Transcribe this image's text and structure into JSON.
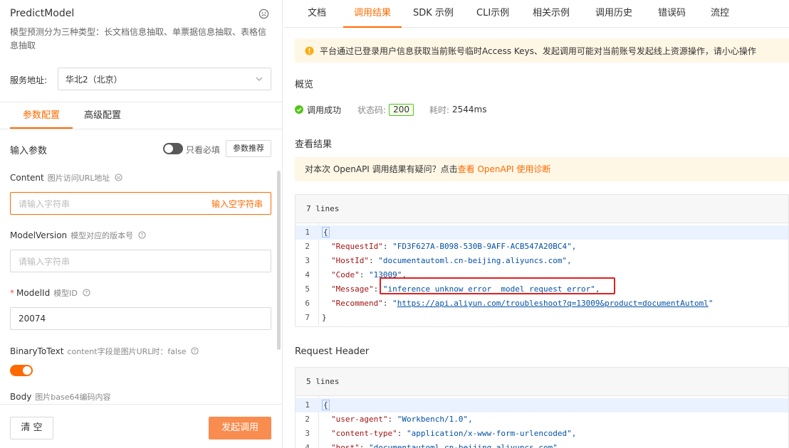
{
  "left": {
    "api_name": "PredictModel",
    "api_desc": "模型预测分为三种类型：长文档信息抽取、单票据信息抽取、表格信息抽取",
    "service_label": "服务地址:",
    "service_value": "华北2（北京）",
    "tabs": [
      {
        "label": "参数配置",
        "active": true
      },
      {
        "label": "高级配置",
        "active": false
      }
    ],
    "input_params_label": "输入参数",
    "only_required_label": "只看必填",
    "recommend_button": "参数推荐",
    "fields": [
      {
        "name": "Content",
        "hint": "图片访问URL地址",
        "placeholder": "请输入字符串",
        "action": "输入空字符串",
        "required": false
      },
      {
        "name": "ModelVersion",
        "hint": "模型对应的版本号",
        "placeholder": "请输入字符串",
        "required": false
      },
      {
        "name": "ModelId",
        "hint": "模型ID",
        "value": "20074",
        "required": true
      },
      {
        "name": "BinaryToText",
        "hint": "content字段是图片URL时：false",
        "toggle_on": true,
        "required": false
      },
      {
        "name": "Body",
        "hint": "图片base64编码内容",
        "required": false
      }
    ],
    "clear_button": "清 空",
    "send_button": "发起调用"
  },
  "right": {
    "tabs": [
      {
        "label": "文档",
        "active": false
      },
      {
        "label": "调用结果",
        "active": true
      },
      {
        "label": "SDK 示例",
        "active": false
      },
      {
        "label": "CLI示例",
        "active": false
      },
      {
        "label": "相关示例",
        "active": false
      },
      {
        "label": "调用历史",
        "active": false
      },
      {
        "label": "错误码",
        "active": false
      },
      {
        "label": "流控",
        "active": false
      }
    ],
    "warning": "平台通过已登录用户信息获取当前账号临时Access Keys、发起调用可能对当前账号发起线上资源操作，请小心操作",
    "overview_title": "概览",
    "status_text": "调用成功",
    "status_code_label": "状态码:",
    "status_code": "200",
    "elapsed_label": "耗时:",
    "elapsed": "2544ms",
    "result_title": "查看结果",
    "tip_prefix": "对本次 OpenAPI 调用结果有疑问？点击",
    "tip_link": "查看 OpenAPI 使用诊断",
    "result_lines_label": "7 lines",
    "result_lines": [
      {
        "n": "1",
        "key": "",
        "val": "{"
      },
      {
        "n": "2",
        "key": "\"RequestId\"",
        "val": "\"FD3F627A-B098-530B-9AFF-ACB547A20BC4\","
      },
      {
        "n": "3",
        "key": "\"HostId\"",
        "val": "\"documentautoml.cn-beijing.aliyuncs.com\","
      },
      {
        "n": "4",
        "key": "\"Code\"",
        "val": "\"13009\","
      },
      {
        "n": "5",
        "key": "\"Message\"",
        "val": "\"inference unknow error  model request error\","
      },
      {
        "n": "6",
        "key": "\"Recommend\"",
        "val": "\"https://api.aliyun.com/troubleshoot?q=13009&product=documentAutoml\""
      },
      {
        "n": "7",
        "key": "",
        "val": "}"
      }
    ],
    "header_title": "Request Header",
    "header_lines_label": "5 lines",
    "header_lines": [
      {
        "n": "1",
        "key": "",
        "val": "{"
      },
      {
        "n": "2",
        "key": "\"user-agent\"",
        "val": "\"Workbench/1.0\","
      },
      {
        "n": "3",
        "key": "\"content-type\"",
        "val": "\"application/x-www-form-urlencoded\","
      },
      {
        "n": "4",
        "key": "\"host\"",
        "val": "\"documentautoml.cn-beijing.aliyuncs.com\""
      }
    ]
  },
  "colors": {
    "accent": "#ff6a00",
    "success": "#52c41a",
    "warning_bg": "#fff7e6",
    "highlight": "#e02020"
  }
}
